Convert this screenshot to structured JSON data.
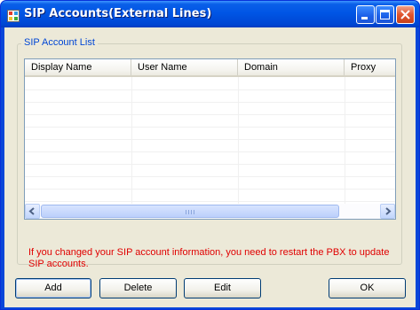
{
  "window": {
    "title": "SIP Accounts(External Lines)"
  },
  "group": {
    "title": "SIP Account List"
  },
  "list": {
    "columns": [
      "Display Name",
      "User Name",
      "Domain",
      "Proxy"
    ],
    "rows": []
  },
  "warning": "If you changed your SIP account information, you need to restart the PBX to update SIP accounts.",
  "buttons": {
    "add": "Add",
    "delete": "Delete",
    "edit": "Edit",
    "ok": "OK"
  },
  "colors": {
    "title_bar": "#0055e5",
    "group_title": "#0046d5",
    "warning": "#e00000",
    "dialog_bg": "#ece9d8"
  },
  "icons": [
    "app-icon",
    "minimize-icon",
    "maximize-icon",
    "close-icon",
    "scroll-left-icon",
    "scroll-right-icon"
  ]
}
